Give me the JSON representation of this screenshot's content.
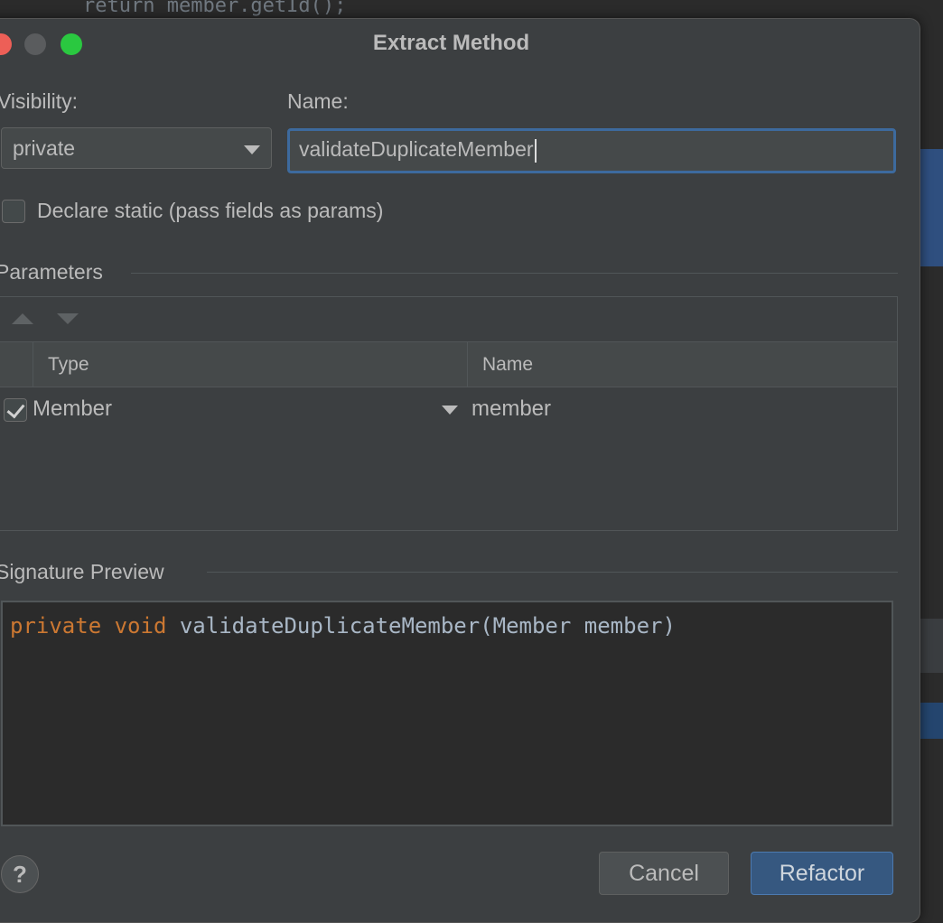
{
  "background": {
    "code_line": "return member.getId();"
  },
  "dialog": {
    "title": "Extract Method",
    "visibility_label": "Visibility:",
    "visibility_value": "private",
    "name_label": "Name:",
    "name_value": "validateDuplicateMember",
    "declare_static_label": "Declare static (pass fields as params)",
    "declare_static_checked": false
  },
  "parameters": {
    "section_title": "Parameters",
    "columns": [
      "Type",
      "Name"
    ],
    "rows": [
      {
        "checked": true,
        "type": "Member",
        "name": "member"
      }
    ]
  },
  "signature": {
    "section_title": "Signature Preview",
    "keyword1": "private",
    "keyword2": "void",
    "rest": " validateDuplicateMember(Member member)"
  },
  "buttons": {
    "help": "?",
    "cancel": "Cancel",
    "refactor": "Refactor"
  },
  "colors": {
    "accent": "#365880",
    "keyword": "#cc7832",
    "code": "#a9b7c6"
  }
}
